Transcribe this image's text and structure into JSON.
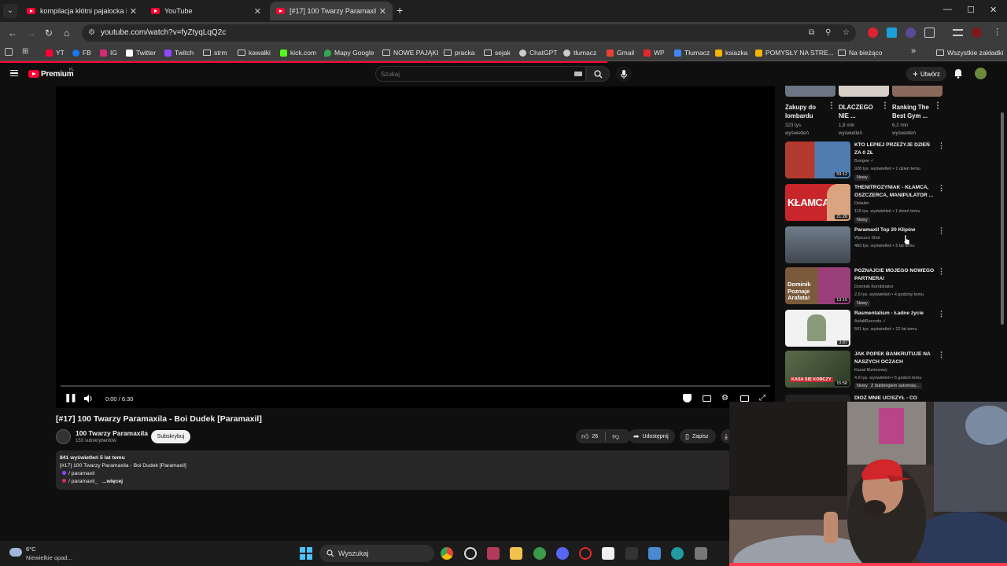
{
  "tabs": [
    {
      "title": "kompilacja kłótni pajalocka i je",
      "close": "✕"
    },
    {
      "title": "YouTube",
      "close": "✕"
    },
    {
      "title": "[#17] 100 Twarzy Paramaxila - B",
      "close": "✕"
    }
  ],
  "new_tab": "+",
  "window_controls": {
    "minimize": "—",
    "maximize": "☐",
    "close": "✕"
  },
  "address": {
    "url": "youtube.com/watch?v=fyZtyqLqQ2c"
  },
  "bookmarks": [
    {
      "label": "YT",
      "color": "#ff0033"
    },
    {
      "label": "FB",
      "color": "#1877f2"
    },
    {
      "label": "IG",
      "color": "#d62976"
    },
    {
      "label": "Twitter",
      "color": "#ffffff"
    },
    {
      "label": "Twitch",
      "color": "#9146ff"
    },
    {
      "label": "strm",
      "folder": true
    },
    {
      "label": "kawałki",
      "folder": true
    },
    {
      "label": "kick.com",
      "color": "#53fc18"
    },
    {
      "label": "Mapy Google",
      "color": "#34a853"
    },
    {
      "label": "NOWE PAJĄKI",
      "folder": true
    },
    {
      "label": "pracka",
      "folder": true
    },
    {
      "label": "sejak",
      "folder": true
    },
    {
      "label": "ChatGPT",
      "color": "#cccccc"
    },
    {
      "label": "tłumacz",
      "color": "#cccccc"
    },
    {
      "label": "Gmail",
      "color": "#ea4335"
    },
    {
      "label": "WP",
      "color": "#e3282c"
    },
    {
      "label": "Tłumacz",
      "color": "#4285f4"
    },
    {
      "label": "ksiazka",
      "color": "#f4b400"
    },
    {
      "label": "POMYSŁY NA STRE...",
      "color": "#f4b400"
    },
    {
      "label": "Na bieżąco",
      "folder": true
    }
  ],
  "bookmarks_more": "»",
  "all_bookmarks": "Wszystkie zakładki",
  "youtube": {
    "brand": "Premium",
    "country": "PL",
    "search_placeholder": "Szukaj",
    "create_label": "Utwórz",
    "player": {
      "time": "0:00 / 6:30"
    },
    "video": {
      "title": "[#17] 100 Twarzy Paramaxila - Boi Dudek [Paramaxil]",
      "channel": "100 Twarzy Paramaxila",
      "subscribers": "153 subskrybentów",
      "subscribe_label": "Subskrybuj",
      "likes": "26",
      "share_label": "Udostępnij",
      "save_label": "Zapisz"
    },
    "description": {
      "stats": "841 wyświetleń  5 lat temu",
      "line1": "[#17] 100 Twarzy Paramaxila - Boi Dudek [Paramaxil]",
      "link1": "/ paramaxil",
      "link2": "/ paramaxil_",
      "more": "...więcej"
    },
    "shorts": [
      {
        "title": "Zakupy do lombardu",
        "views": "323 tys. wyświetleń"
      },
      {
        "title": "DLACZEGO NIE ...",
        "views": "1,8 mln wyświetleń"
      },
      {
        "title": "Ranking The Best Gym ...",
        "views": "6,2 mln wyświetleń"
      }
    ],
    "recommendations": [
      {
        "title": "KTO LEPIEJ PRZEŻYJE DZIEŃ ZA 0 ZŁ",
        "channel": "Bungee ✓",
        "meta": "928 tys. wyświetleń • 1 dzień temu",
        "badge": "Nowy",
        "duration": "59:12",
        "thumb_color": "#b33a2e"
      },
      {
        "title": "THENITROZYNIAK - KŁAMCA, OSZCZERCA, MANIPULATOR ...",
        "channel": "Detailer",
        "meta": "115 tys. wyświetleń • 1 dzień temu",
        "badge": "Nowy",
        "duration": "21:28",
        "thumb_color": "#c8262b",
        "thumb_text": "KŁAMCA"
      },
      {
        "title": "Paramaxil Top 20 Klipów",
        "channel": "Wpozzo Shot",
        "meta": "483 tys. wyświetleń • 5 lat temu",
        "duration": "",
        "thumb_color": "#5a6470"
      },
      {
        "title": "POZNAJCIE MOJEGO NOWEGO PARTNERA!",
        "channel": "Dominik Kombinator",
        "meta": "2,6 tys. wyświetleń • 4 godziny temu",
        "badge": "Nowy",
        "duration": "13:15",
        "thumb_color": "#8a3d6a",
        "thumb_text": "Dominik Poznaje Arafata!"
      },
      {
        "title": "Rasmentalism - Ładne życie",
        "channel": "AsfaltRecords ✓",
        "meta": "501 tys. wyświetleń • 12 lat temu",
        "duration": "3:37",
        "thumb_color": "#dcdcdc"
      },
      {
        "title": "JAK POPEK BANKRUTUJE NA NASZYCH OCZACH",
        "channel": "Kanał Biznesowy",
        "meta": "4,9 tys. wyświetleń • 5 godzin temu",
        "badge": "Nowy",
        "badge2": "Z dubbingiem automaty...",
        "duration": "15:58",
        "thumb_color": "#3a4a2e",
        "thumb_text": "KASA SIĘ KOŃCZY"
      },
      {
        "title": "DIOZ MNIE UCISZYŁ - CO",
        "channel": "",
        "meta": "",
        "duration": "",
        "thumb_color": "#222222"
      }
    ]
  },
  "taskbar": {
    "temperature": "6°C",
    "weather": "Niewielkie opad...",
    "search_label": "Wyszukaj"
  }
}
